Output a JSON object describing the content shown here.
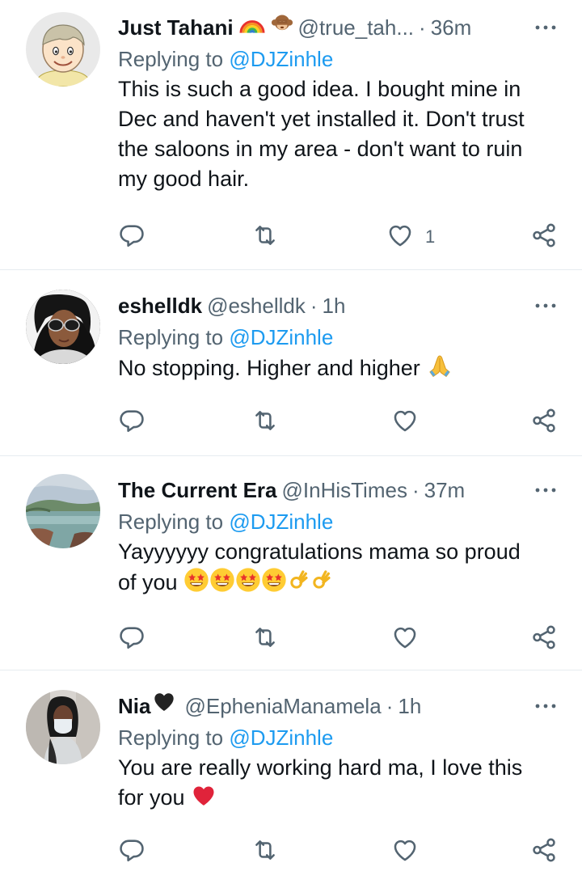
{
  "replies": [
    {
      "display_name": "Just Tahani",
      "name_emoji": [
        "rainbow-emoji",
        "monkey-emoji"
      ],
      "handle": "@true_tah...",
      "separator": "·",
      "time": "36m",
      "replying_prefix": "Replying to",
      "replying_to": "@DJZinhle",
      "text_lines": [
        "This is such a good idea. I bought mine in",
        "Dec and haven't yet installed it. Don't trust",
        "the saloons in my area - don't want to ruin",
        "my good hair."
      ],
      "like_count": "1",
      "avatar": "cartoon-boy-avatar"
    },
    {
      "display_name": "eshelldk",
      "handle": "@eshelldk",
      "separator": "·",
      "time": "1h",
      "replying_prefix": "Replying to",
      "replying_to": "@DJZinhle",
      "text_lines": [
        "No stopping. Higher and higher"
      ],
      "text_emoji": [
        "praying-hands-emoji"
      ],
      "like_count": "",
      "avatar": "woman-sunglasses-avatar"
    },
    {
      "display_name": "The Current Era",
      "handle": "@InHisTimes",
      "separator": "·",
      "time": "37m",
      "replying_prefix": "Replying to",
      "replying_to": "@DJZinhle",
      "text_lines": [
        "Yayyyyyy congratulations mama so proud",
        "of you"
      ],
      "text_emoji": [
        "star-struck-emoji",
        "star-struck-emoji",
        "star-struck-emoji",
        "star-struck-emoji",
        "ok-hand-emoji",
        "ok-hand-emoji"
      ],
      "like_count": "",
      "avatar": "landscape-avatar"
    },
    {
      "display_name": "Nia",
      "name_emoji": [
        "black-heart-emoji"
      ],
      "handle": "@EpheniaManamela",
      "separator": "·",
      "time": "1h",
      "replying_prefix": "Replying to",
      "replying_to": "@DJZinhle",
      "text_lines": [
        "You are really working hard ma, I love this",
        "for you"
      ],
      "text_emoji": [
        "red-heart-emoji"
      ],
      "like_count": "",
      "avatar": "woman-mask-avatar"
    }
  ],
  "colors": {
    "text": "#0f1419",
    "secondary": "#536471",
    "link": "#1d9bf0",
    "divider": "#e6ecf0"
  },
  "icons": [
    "reply-icon",
    "retweet-icon",
    "like-icon",
    "share-icon",
    "more-icon"
  ]
}
